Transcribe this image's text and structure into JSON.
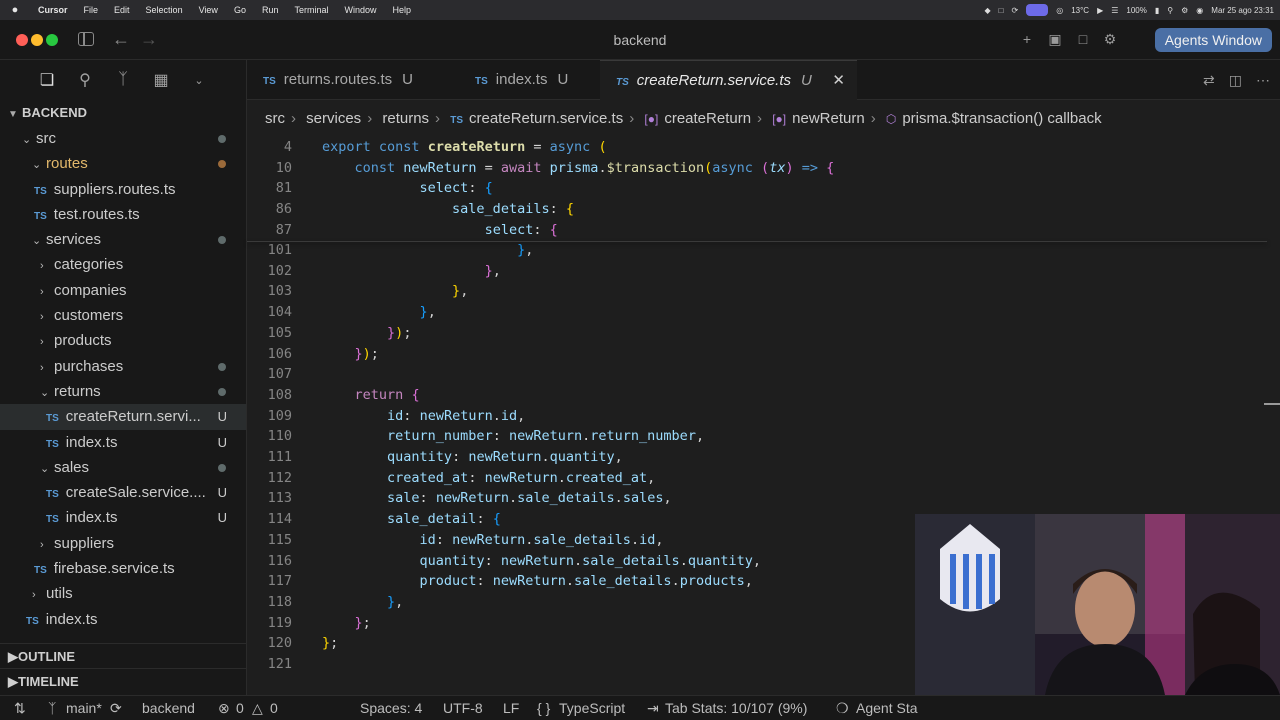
{
  "menubar": {
    "app": "Cursor",
    "items": [
      "File",
      "Edit",
      "Selection",
      "View",
      "Go",
      "Run",
      "Terminal",
      "Window",
      "Help"
    ],
    "temperature": "13°C",
    "battery": "100%",
    "datetime": "Mar 25 ago  23:31"
  },
  "window": {
    "title": "backend",
    "agents_button": "Agents Window"
  },
  "sidebar": {
    "project": "BACKEND",
    "tree": [
      {
        "label": "src",
        "depth": 1,
        "type": "folder-open",
        "badge": "",
        "dot": "gray"
      },
      {
        "label": "routes",
        "depth": 2,
        "type": "folder-open",
        "badge": "",
        "dot": "orange"
      },
      {
        "label": "suppliers.routes.ts",
        "depth": 3,
        "type": "ts",
        "badge": "",
        "dot": ""
      },
      {
        "label": "test.routes.ts",
        "depth": 3,
        "type": "ts",
        "badge": "",
        "dot": ""
      },
      {
        "label": "services",
        "depth": 2,
        "type": "folder-open",
        "badge": "",
        "dot": "gray"
      },
      {
        "label": "categories",
        "depth": 3,
        "type": "folder",
        "badge": "",
        "dot": ""
      },
      {
        "label": "companies",
        "depth": 3,
        "type": "folder",
        "badge": "",
        "dot": ""
      },
      {
        "label": "customers",
        "depth": 3,
        "type": "folder",
        "badge": "",
        "dot": ""
      },
      {
        "label": "products",
        "depth": 3,
        "type": "folder",
        "badge": "",
        "dot": ""
      },
      {
        "label": "purchases",
        "depth": 3,
        "type": "folder",
        "badge": "",
        "dot": "gray"
      },
      {
        "label": "returns",
        "depth": 3,
        "type": "folder-open",
        "badge": "",
        "dot": "gray"
      },
      {
        "label": "createReturn.servi...",
        "depth": 4,
        "type": "ts",
        "badge": "U",
        "dot": "",
        "selected": true
      },
      {
        "label": "index.ts",
        "depth": 4,
        "type": "ts",
        "badge": "U",
        "dot": ""
      },
      {
        "label": "sales",
        "depth": 3,
        "type": "folder-open",
        "badge": "",
        "dot": "gray"
      },
      {
        "label": "createSale.service....",
        "depth": 4,
        "type": "ts",
        "badge": "U",
        "dot": ""
      },
      {
        "label": "index.ts",
        "depth": 4,
        "type": "ts",
        "badge": "U",
        "dot": ""
      },
      {
        "label": "suppliers",
        "depth": 3,
        "type": "folder",
        "badge": "",
        "dot": ""
      },
      {
        "label": "firebase.service.ts",
        "depth": 3,
        "type": "ts",
        "badge": "",
        "dot": ""
      },
      {
        "label": "utils",
        "depth": 2,
        "type": "folder",
        "badge": "",
        "dot": ""
      },
      {
        "label": "index.ts",
        "depth": 2,
        "type": "ts",
        "badge": "",
        "dot": ""
      }
    ],
    "outline": "OUTLINE",
    "timeline": "TIMELINE"
  },
  "tabs": [
    {
      "label": "returns.routes.ts",
      "mod": "U",
      "active": false
    },
    {
      "label": "index.ts",
      "mod": "U",
      "active": false
    },
    {
      "label": "createReturn.service.ts",
      "mod": "U",
      "active": true
    }
  ],
  "breadcrumb": [
    "src",
    "services",
    "returns",
    "createReturn.service.ts",
    "createReturn",
    "newReturn",
    "prisma.$transaction() callback"
  ],
  "editor": {
    "lines": [
      {
        "n": "4",
        "html": "<span class='kb'>export</span> <span class='kb'>const</span> <span class='f bold'>createReturn</span> <span class='p'>=</span> <span class='kb'>async</span> <span class='b1'>(</span>"
      },
      {
        "n": "10",
        "html": "    <span class='kb'>const</span> <span class='v'>newReturn</span> <span class='p'>=</span> <span class='k'>await</span> <span class='v'>prisma</span><span class='p'>.</span><span class='f'>$transaction</span><span class='b1'>(</span><span class='kb'>async</span> <span class='b2'>(</span><span class='v it'>tx</span><span class='b2'>)</span> <span class='kb'>=&gt;</span> <span class='b2'>{</span>"
      },
      {
        "n": "81",
        "html": "            <span class='v'>select</span><span class='p'>:</span> <span class='b3'>{</span>"
      },
      {
        "n": "86",
        "html": "                <span class='v'>sale_details</span><span class='p'>:</span> <span class='b1'>{</span>"
      },
      {
        "n": "87",
        "html": "                    <span class='v'>select</span><span class='p'>:</span> <span class='b2'>{</span>"
      },
      {
        "n": "101",
        "html": "                        <span class='b3'>}</span><span class='p'>,</span>"
      },
      {
        "n": "102",
        "html": "                    <span class='b2'>}</span><span class='p'>,</span>"
      },
      {
        "n": "103",
        "html": "                <span class='b1'>}</span><span class='p'>,</span>"
      },
      {
        "n": "104",
        "html": "            <span class='b3'>}</span><span class='p'>,</span>"
      },
      {
        "n": "105",
        "html": "        <span class='b2'>}</span><span class='b1'>)</span><span class='p'>;</span>"
      },
      {
        "n": "106",
        "html": "    <span class='b2'>}</span><span class='b1'>)</span><span class='p'>;</span>"
      },
      {
        "n": "107",
        "html": ""
      },
      {
        "n": "108",
        "html": "    <span class='k'>return</span> <span class='b2'>{</span>"
      },
      {
        "n": "109",
        "html": "        <span class='v'>id</span><span class='p'>:</span> <span class='v'>newReturn</span><span class='p'>.</span><span class='v'>id</span><span class='p'>,</span>"
      },
      {
        "n": "110",
        "html": "        <span class='v'>return_number</span><span class='p'>:</span> <span class='v'>newReturn</span><span class='p'>.</span><span class='v'>return_number</span><span class='p'>,</span>"
      },
      {
        "n": "111",
        "html": "        <span class='v'>quantity</span><span class='p'>:</span> <span class='v'>newReturn</span><span class='p'>.</span><span class='v'>quantity</span><span class='p'>,</span>"
      },
      {
        "n": "112",
        "html": "        <span class='v'>created_at</span><span class='p'>:</span> <span class='v'>newReturn</span><span class='p'>.</span><span class='v'>created_at</span><span class='p'>,</span>"
      },
      {
        "n": "113",
        "html": "        <span class='v'>sale</span><span class='p'>:</span> <span class='v'>newReturn</span><span class='p'>.</span><span class='v'>sale_details</span><span class='p'>.</span><span class='v'>sales</span><span class='p'>,</span>"
      },
      {
        "n": "114",
        "html": "        <span class='v'>sale_detail</span><span class='p'>:</span> <span class='b3'>{</span>"
      },
      {
        "n": "115",
        "html": "            <span class='v'>id</span><span class='p'>:</span> <span class='v'>newReturn</span><span class='p'>.</span><span class='v'>sale_details</span><span class='p'>.</span><span class='v'>id</span><span class='p'>,</span>"
      },
      {
        "n": "116",
        "html": "            <span class='v'>quantity</span><span class='p'>:</span> <span class='v'>newReturn</span><span class='p'>.</span><span class='v'>sale_details</span><span class='p'>.</span><span class='v'>quantity</span><span class='p'>,</span>"
      },
      {
        "n": "117",
        "html": "            <span class='v'>product</span><span class='p'>:</span> <span class='v'>newReturn</span><span class='p'>.</span><span class='v'>sale_details</span><span class='p'>.</span><span class='v'>products</span><span class='p'>,</span>"
      },
      {
        "n": "118",
        "html": "        <span class='b3'>}</span><span class='p'>,</span>"
      },
      {
        "n": "119",
        "html": "    <span class='b2'>}</span><span class='p'>;</span>"
      },
      {
        "n": "120",
        "html": "<span class='b1'>}</span><span class='p'>;</span>"
      },
      {
        "n": "121",
        "html": ""
      }
    ]
  },
  "statusbar": {
    "branch": "main*",
    "folder": "backend",
    "errors": "0",
    "warnings": "0",
    "spaces": "Spaces: 4",
    "encoding": "UTF-8",
    "eol": "LF",
    "language": "TypeScript",
    "tab_stats": "Tab Stats: 10/107 (9%)",
    "agent": "Agent Sta"
  },
  "colors": {
    "accent": "#4a6fa5",
    "keyword": "#569cd6",
    "control": "#c586c0",
    "function": "#dcdcaa",
    "variable": "#9cdcfe"
  }
}
